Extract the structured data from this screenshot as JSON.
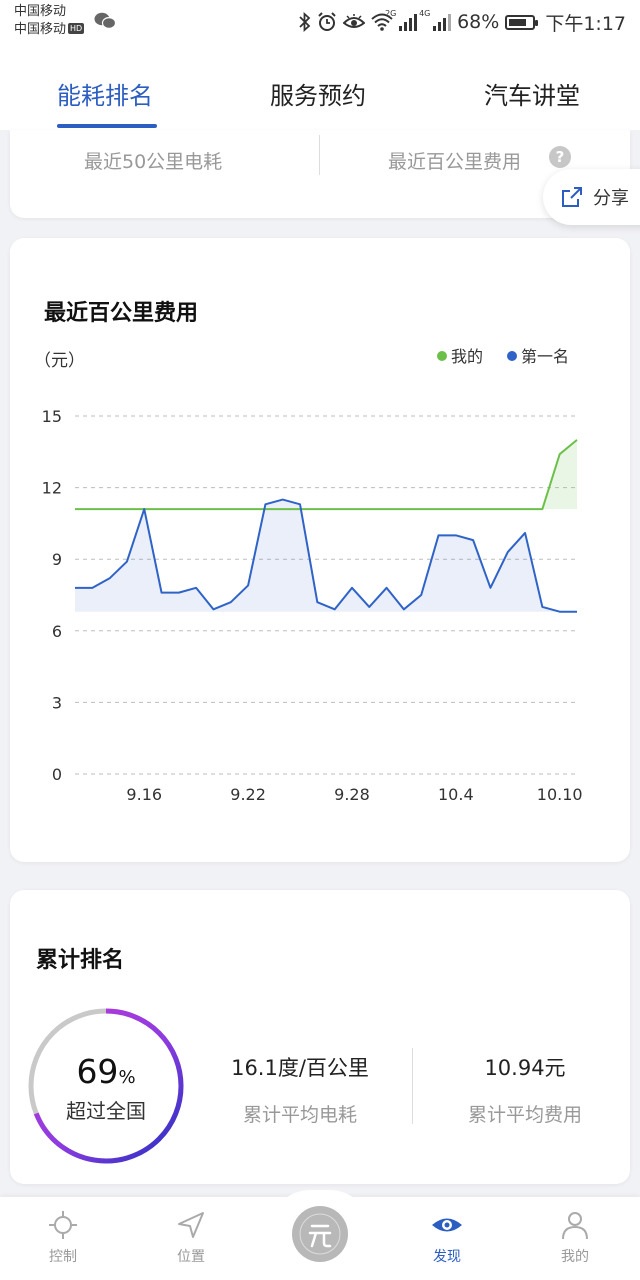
{
  "status_bar": {
    "carrier1": "中国移动",
    "carrier2": "中国移动",
    "hd": "HD",
    "sig1_type": "2G",
    "sig2_type": "4G",
    "battery": "68%",
    "time": "下午1:17"
  },
  "tabs": [
    {
      "label": "能耗排名",
      "active": true
    },
    {
      "label": "服务预约",
      "active": false
    },
    {
      "label": "汽车讲堂",
      "active": false
    }
  ],
  "summary": {
    "left_label": "最近50公里电耗",
    "right_label": "最近百公里费用",
    "help_icon": "?"
  },
  "share": {
    "label": "分享"
  },
  "cost_chart": {
    "title": "最近百公里费用",
    "unit": "（元）"
  },
  "chart_data": {
    "type": "area",
    "title": "最近百公里费用",
    "ylabel": "（元）",
    "ylim": [
      0,
      15
    ],
    "yticks": [
      "15",
      "12",
      "9",
      "6",
      "3",
      "0"
    ],
    "xtick_labels": [
      "9.16",
      "9.22",
      "9.28",
      "10.4",
      "10.10"
    ],
    "xtick_index": [
      4,
      10,
      16,
      22,
      28
    ],
    "grid": true,
    "legend_position": "top-right",
    "series": [
      {
        "name": "我的",
        "color": "#6cc04a",
        "values": [
          11.1,
          11.1,
          11.1,
          11.1,
          11.1,
          11.1,
          11.1,
          11.1,
          11.1,
          11.1,
          11.1,
          11.1,
          11.1,
          11.1,
          11.1,
          11.1,
          11.1,
          11.1,
          11.1,
          11.1,
          11.1,
          11.1,
          11.1,
          11.1,
          11.1,
          11.1,
          11.1,
          11.1,
          13.4,
          14.0
        ]
      },
      {
        "name": "第一名",
        "color": "#2f63c7",
        "values": [
          7.8,
          7.8,
          8.2,
          8.9,
          11.1,
          7.6,
          7.6,
          7.8,
          6.9,
          7.2,
          7.9,
          11.3,
          11.5,
          11.3,
          7.2,
          6.9,
          7.8,
          7.0,
          7.8,
          6.9,
          7.5,
          10.0,
          10.0,
          9.8,
          7.8,
          9.3,
          10.1,
          7.0,
          6.8,
          6.8
        ]
      }
    ]
  },
  "ranking": {
    "title": "累计排名",
    "percent": "69",
    "percent_sign": "%",
    "percent_label": "超过全国",
    "percent_value": 69,
    "avg_energy_value": "16.1度/百公里",
    "avg_energy_label": "累计平均电耗",
    "avg_cost_value": "10.94元",
    "avg_cost_label": "累计平均费用"
  },
  "bottom_nav": [
    {
      "label": "控制",
      "icon": "control-icon",
      "active": false
    },
    {
      "label": "位置",
      "icon": "location-icon",
      "active": false
    },
    {
      "label": "",
      "icon": "center-logo-icon",
      "active": false
    },
    {
      "label": "发现",
      "icon": "eye-icon",
      "active": true
    },
    {
      "label": "我的",
      "icon": "profile-icon",
      "active": false
    }
  ],
  "colors": {
    "accent": "#2c5ec2",
    "mine": "#6cc04a",
    "first": "#2f63c7"
  }
}
